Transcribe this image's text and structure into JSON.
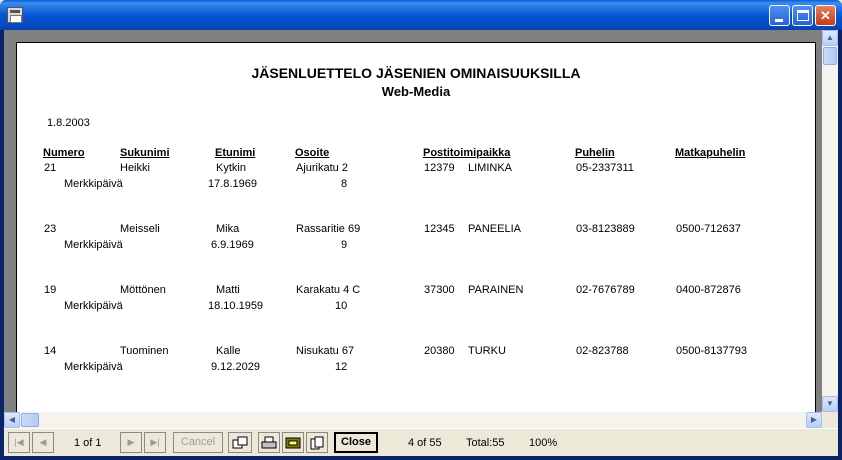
{
  "report": {
    "title": "JÄSENLUETTELO JÄSENIEN OMINAISUUKSILLA",
    "subtitle": "Web-Media",
    "date": "1.8.2003",
    "columns": [
      "Numero",
      "Sukunimi",
      "Etunimi",
      "Osoite",
      "Postitoimipaikka",
      "Puhelin",
      "Matkapuhelin"
    ],
    "sub_label": "Merkkipäivä",
    "rows": [
      {
        "numero": "21",
        "sukunimi": "Heikki",
        "etunimi": "Kytkin",
        "osoite": "Ajurikatu 2",
        "postinumero": "12379",
        "postitoimipaikka": "LIMINKA",
        "puhelin": "05-2337311",
        "matkapuhelin": "",
        "merkkipaiva": "17.8.1969",
        "luku": "8"
      },
      {
        "numero": "23",
        "sukunimi": "Meisseli",
        "etunimi": "Mika",
        "osoite": "Rassaritie 69",
        "postinumero": "12345",
        "postitoimipaikka": "PANEELIA",
        "puhelin": "03-8123889",
        "matkapuhelin": "0500-712637",
        "merkkipaiva": "6.9.1969",
        "luku": "9"
      },
      {
        "numero": "19",
        "sukunimi": "Möttönen",
        "etunimi": "Matti",
        "osoite": "Karakatu 4 C",
        "postinumero": "37300",
        "postitoimipaikka": "PARAINEN",
        "puhelin": "02-7676789",
        "matkapuhelin": "0400-872876",
        "merkkipaiva": "18.10.1959",
        "luku": "10"
      },
      {
        "numero": "14",
        "sukunimi": "Tuominen",
        "etunimi": "Kalle",
        "osoite": "Nisukatu 67",
        "postinumero": "20380",
        "postitoimipaikka": "TURKU",
        "puhelin": "02-823788",
        "matkapuhelin": "0500-8137793",
        "merkkipaiva": "9.12.2029",
        "luku": "12"
      }
    ]
  },
  "toolbar": {
    "page_indicator": "1 of 1",
    "cancel_label": "Cancel",
    "close_label": "Close",
    "record_position": "4 of 55",
    "total": "Total:55",
    "zoom": "100%"
  },
  "icons": {
    "first": "first-page-icon",
    "prev": "prev-page-icon",
    "next": "next-page-icon",
    "last": "last-page-icon",
    "export": "export-icon",
    "print": "print-icon",
    "print_setup": "print-setup-icon",
    "zoom": "zoom-icon"
  }
}
